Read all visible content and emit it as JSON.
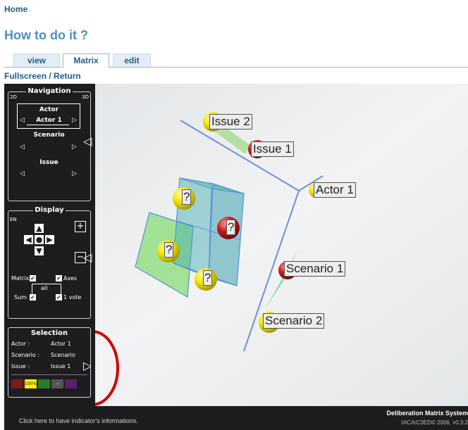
{
  "header": {
    "home": "Home",
    "title": "How to do it ?"
  },
  "tabs": [
    {
      "label": "view",
      "active": false
    },
    {
      "label": "Matrix",
      "active": true
    },
    {
      "label": "edit",
      "active": false
    }
  ],
  "links": {
    "fullscreen": "Fullscreen",
    "separator": " / ",
    "return": "Return"
  },
  "navigation": {
    "title": "Navigation",
    "mode_2d": "2D",
    "mode_3d": "3D",
    "actor_label": "Actor",
    "actor_value": "Actor 1",
    "scenario_label": "Scenario",
    "issue_label": "Issue"
  },
  "display": {
    "title": "Display",
    "lang": "EN",
    "matrix_label": "Matrix",
    "axes_label": "Axes",
    "all_label": "all",
    "sum_label": "Sum",
    "vote_label": "1 vote"
  },
  "selection": {
    "title": "Selection",
    "actor_key": "Actor :",
    "actor_val": "Actor 1",
    "scenario_key": "Scenario :",
    "scenario_val": "Scenario",
    "issue_key": "Issue :",
    "issue_val": "Issue 1",
    "swatches": [
      {
        "color": "#7a1c1c",
        "text": ""
      },
      {
        "color": "#ffee00",
        "text": "100%"
      },
      {
        "color": "#2a7a2a",
        "text": ""
      },
      {
        "color": "#555555",
        "text": "—"
      },
      {
        "color": "#5b1f6e",
        "text": ""
      }
    ]
  },
  "scene_labels": {
    "issue2": "Issue 2",
    "issue1": "Issue 1",
    "actor1": "Actor 1",
    "scenario1": "Scenario 1",
    "scenario2": "Scenario 2",
    "unknown": "?"
  },
  "footer": {
    "hint": "Click here to have indicator's informations.",
    "brand": "Deliberation Matrix System",
    "copyright": "IACA/C3ED© 2006, v0.3.2"
  },
  "colors": {
    "link": "#1f5d8c",
    "title": "#4d8ec4",
    "panel": "#1d1d1f",
    "highlight_circle": "#d40000",
    "yellow": "#f2e600",
    "red": "#d01818"
  }
}
